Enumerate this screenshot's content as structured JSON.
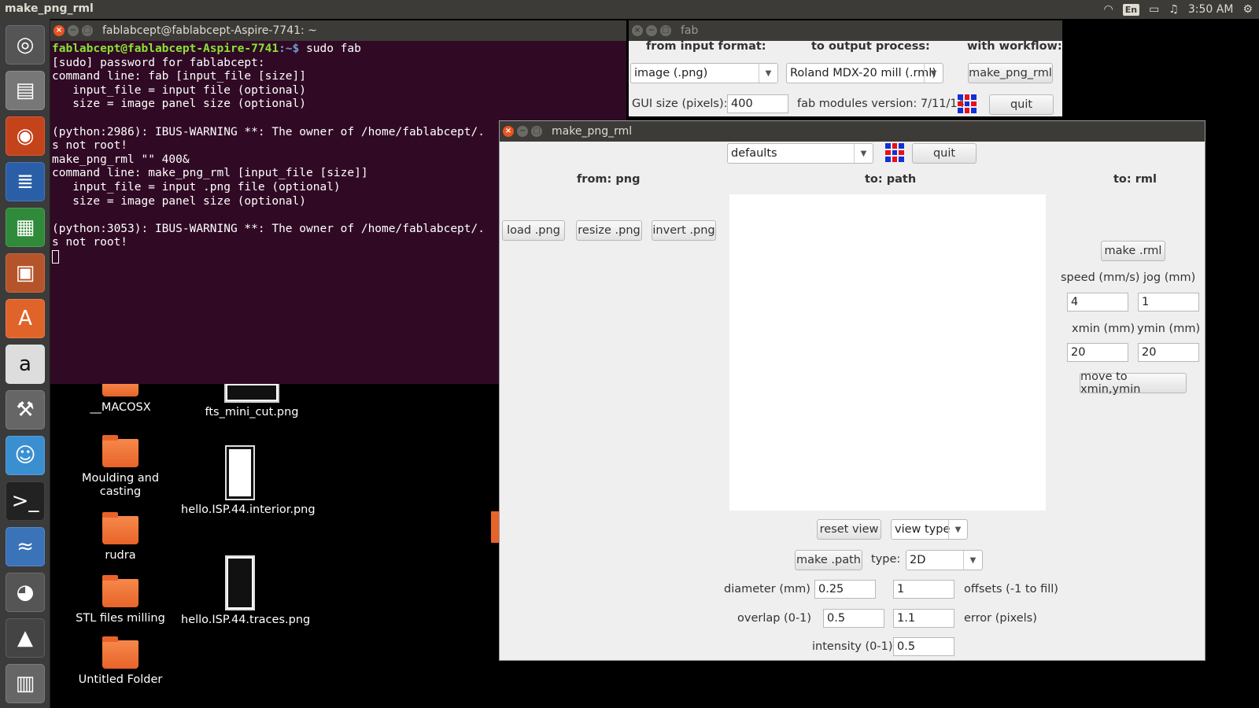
{
  "topbar": {
    "app_title": "make_png_rml",
    "lang": "En",
    "clock": "3:50 AM"
  },
  "launcher": {
    "items": [
      "ubuntu-dash",
      "files",
      "firefox",
      "writer",
      "calc",
      "impress",
      "software-center",
      "amazon",
      "settings",
      "empathy",
      "terminal",
      "python",
      "gimp",
      "inkscape",
      "workspaces"
    ]
  },
  "terminal": {
    "title": "fablabcept@fablabcept-Aspire-7741: ~",
    "prompt_user": "fablabcept@fablabcept-Aspire-7741",
    "prompt_path": ":~$ ",
    "command": "sudo fab",
    "lines": [
      "[sudo] password for fablabcept:",
      "command line: fab [input_file [size]]",
      "   input_file = input file (optional)",
      "   size = image panel size (optional)",
      "",
      "(python:2986): IBUS-WARNING **: The owner of /home/fablabcept/.",
      "s not root!",
      "make_png_rml \"\" 400&",
      "command line: make_png_rml [input_file [size]]",
      "   input_file = input .png file (optional)",
      "   size = image panel size (optional)",
      "",
      "(python:3053): IBUS-WARNING **: The owner of /home/fablabcept/.",
      "s not root!"
    ]
  },
  "desktop": {
    "icons": [
      {
        "label": "__MACOSX",
        "kind": "folder"
      },
      {
        "label": "Moulding and casting",
        "kind": "folder"
      },
      {
        "label": "rudra",
        "kind": "folder"
      },
      {
        "label": "STL files milling",
        "kind": "folder"
      },
      {
        "label": "Untitled Folder",
        "kind": "folder"
      },
      {
        "label": "fts_mini_cut.png",
        "kind": "image"
      },
      {
        "label": "hello.ISP.44.interior.png",
        "kind": "image"
      },
      {
        "label": "hello.ISP.44.traces.png",
        "kind": "image"
      }
    ]
  },
  "fab": {
    "title": "fab",
    "from_label": "from input format:",
    "to_label": "to output process:",
    "workflow_label": "with workflow:",
    "input_format": "image (.png)",
    "output_process": "Roland MDX-20 mill (.rml)",
    "workflow_button": "make_png_rml",
    "gui_size_label": "GUI size (pixels):",
    "gui_size_value": "400",
    "version": "fab modules version: 7/11/14",
    "quit": "quit"
  },
  "mpr": {
    "title": "make_png_rml",
    "defaults": "defaults",
    "quit": "quit",
    "from_header": "from: png",
    "path_header": "to: path",
    "rml_header": "to: rml",
    "load_png": "load .png",
    "resize_png": "resize .png",
    "invert_png": "invert .png",
    "make_rml": "make .rml",
    "speed_label": "speed (mm/s)",
    "jog_label": "jog (mm)",
    "speed_value": "4",
    "jog_value": "1",
    "xmin_label": "xmin (mm)",
    "ymin_label": "ymin (mm)",
    "xmin_value": "20",
    "ymin_value": "20",
    "move_button": "move to xmin,ymin",
    "reset_view": "reset view",
    "view_type": "view type",
    "make_path": "make .path",
    "type_label": "type:",
    "type_value": "2D",
    "diameter_label": "diameter (mm)",
    "diameter_value": "0.25",
    "offsets_value": "1",
    "offsets_label": "offsets (-1 to fill)",
    "overlap_label": "overlap (0-1)",
    "overlap_value": "0.5",
    "error_value": "1.1",
    "error_label": "error (pixels)",
    "intensity_label": "intensity (0-1)",
    "intensity_value": "0.5"
  },
  "colors": {
    "terminal_bg": "#300a24",
    "panel_bg": "#3c3b37",
    "accent": "#e95420",
    "window_bg": "#efefef"
  }
}
